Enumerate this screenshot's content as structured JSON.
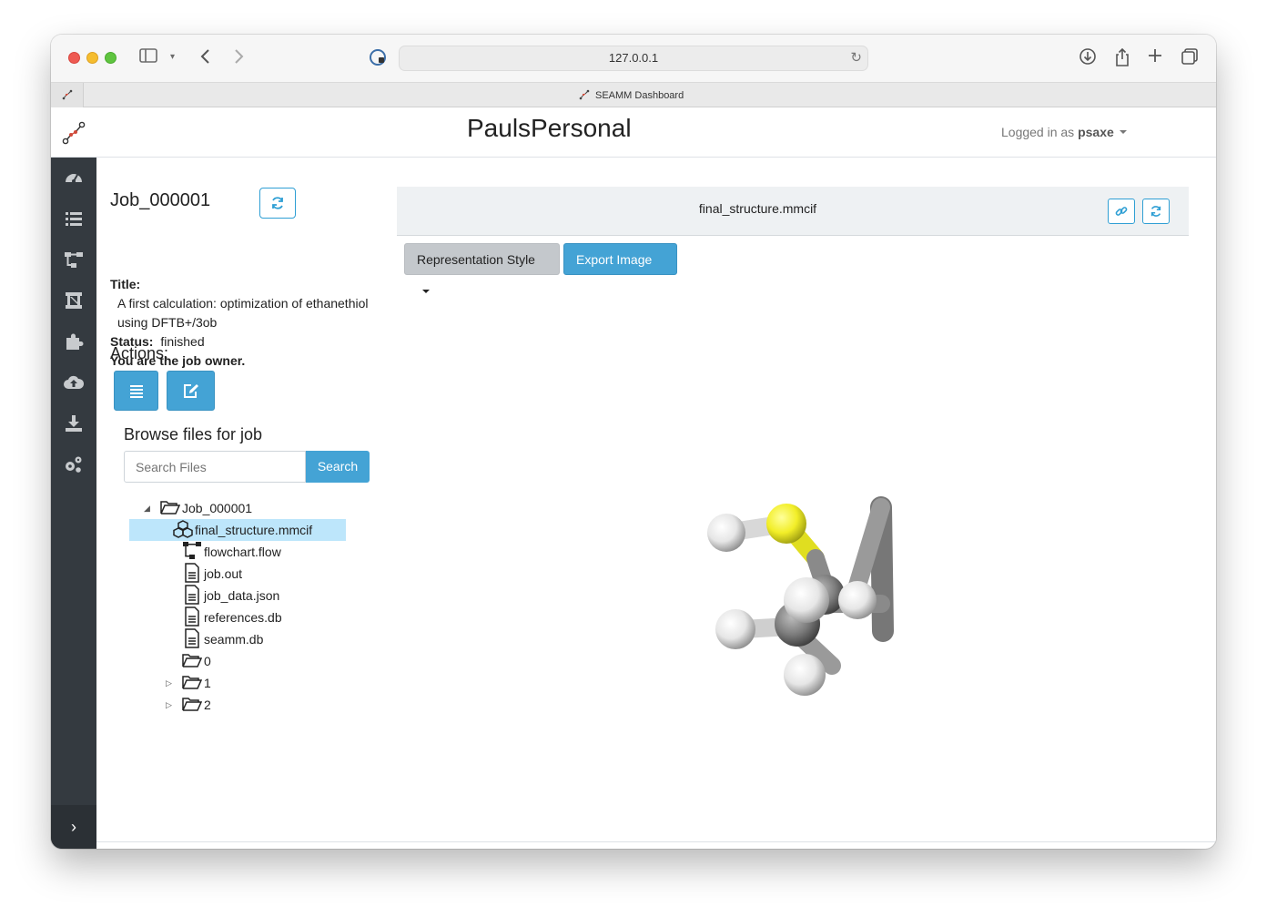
{
  "browser": {
    "url": "127.0.0.1",
    "tab_title": "SEAMM Dashboard"
  },
  "header": {
    "title": "PaulsPersonal",
    "login_prefix": "Logged in as",
    "username": "psaxe"
  },
  "sidebar": {
    "items": [
      {
        "icon": "dashboard-icon"
      },
      {
        "icon": "list-icon"
      },
      {
        "icon": "flowchart-icon"
      },
      {
        "icon": "projects-icon"
      },
      {
        "icon": "plugins-icon"
      },
      {
        "icon": "upload-icon"
      },
      {
        "icon": "download-icon"
      },
      {
        "icon": "settings-icon"
      }
    ],
    "expand_icon": "chevron-right-icon"
  },
  "job": {
    "name": "Job_000001",
    "title_label": "Title:",
    "title_line1": "A first calculation: optimization of ethanethiol",
    "title_line2": "using DFTB+/3ob",
    "status_label": "Status:",
    "status_value": "finished",
    "owner_note": "You are the job owner.",
    "actions_label": "Actions:"
  },
  "files": {
    "heading": "Browse files for job",
    "search_placeholder": "Search Files",
    "search_button": "Search",
    "root": "Job_000001",
    "items": [
      "final_structure.mmcif",
      "flowchart.flow",
      "job.out",
      "job_data.json",
      "references.db",
      "seamm.db"
    ],
    "folders": [
      "0",
      "1",
      "2"
    ],
    "selected": "final_structure.mmcif"
  },
  "viewer": {
    "file_name": "final_structure.mmcif",
    "representation_button": "Representation Style",
    "export_button": "Export Image"
  },
  "colors": {
    "accent": "#44a3d5",
    "sidebar": "#343a40",
    "selection": "#bde6fb",
    "sulfur": "#ffff30",
    "carbon": "#808080",
    "hydrogen": "#ffffff"
  }
}
